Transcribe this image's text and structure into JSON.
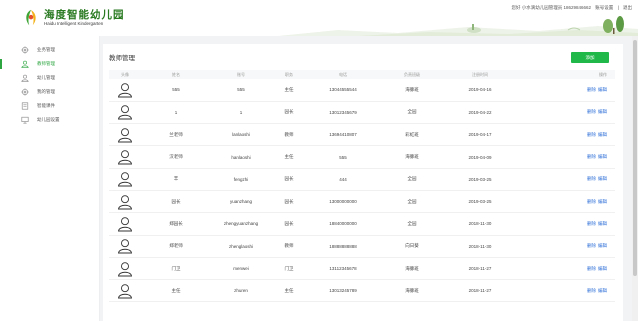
{
  "header": {
    "logo_cn": "海度智能幼儿园",
    "logo_en": "Haidu Intelligent Kindergarten",
    "user_text": "您好 小水滴幼儿园管理员 18629846662",
    "account_settings": "账号设置",
    "logout": "退出"
  },
  "sidebar": {
    "items": [
      {
        "label": "业务管理",
        "icon": "gear-icon"
      },
      {
        "label": "教师管理",
        "icon": "user-icon"
      },
      {
        "label": "幼儿管理",
        "icon": "user-icon"
      },
      {
        "label": "我的管理",
        "icon": "gear-icon"
      },
      {
        "label": "智能课件",
        "icon": "book-icon"
      },
      {
        "label": "幼儿园设置",
        "icon": "monitor-icon"
      }
    ]
  },
  "panel": {
    "title": "教师管理",
    "add_label": "添加"
  },
  "table": {
    "columns": [
      "头像",
      "姓名",
      "账号",
      "职务",
      "电话",
      "负责班级",
      "注册时间",
      "操作"
    ],
    "delete_label": "删除",
    "edit_label": "编辑",
    "rows": [
      {
        "name": "555",
        "account": "555",
        "role": "主任",
        "phone": "13044555544",
        "class": "海豚班",
        "date": "2019-04-16"
      },
      {
        "name": "1",
        "account": "1",
        "role": "园长",
        "phone": "13012345679",
        "class": "全园",
        "date": "2019-04-22"
      },
      {
        "name": "兰老师",
        "account": "lanlaoshi",
        "role": "教师",
        "phone": "13694410807",
        "class": "彩虹班",
        "date": "2019-04-17"
      },
      {
        "name": "汉老师",
        "account": "hanlaoshi",
        "role": "主任",
        "phone": "555",
        "class": "海豚班",
        "date": "2019-04-09"
      },
      {
        "name": "丰",
        "account": "fengzhi",
        "role": "园长",
        "phone": "444",
        "class": "全园",
        "date": "2019-03-25"
      },
      {
        "name": "园长",
        "account": "yuanzhang",
        "role": "园长",
        "phone": "13000000000",
        "class": "全园",
        "date": "2019-03-25"
      },
      {
        "name": "郑园长",
        "account": "zhengyuanzhang",
        "role": "园长",
        "phone": "18840000000",
        "class": "全园",
        "date": "2018-11-30"
      },
      {
        "name": "郑老师",
        "account": "zhenglaoshi",
        "role": "教师",
        "phone": "18888888888",
        "class": "向日葵",
        "date": "2018-11-30"
      },
      {
        "name": "门卫",
        "account": "menwei",
        "role": "门卫",
        "phone": "13112345678",
        "class": "海豚班",
        "date": "2018-11-27"
      },
      {
        "name": "主任",
        "account": "zhuren",
        "role": "主任",
        "phone": "13013245789",
        "class": "海豚班",
        "date": "2018-11-27"
      }
    ]
  },
  "colors": {
    "accent": "#2da641",
    "button": "#21b84a",
    "link": "#2f6fd8"
  }
}
